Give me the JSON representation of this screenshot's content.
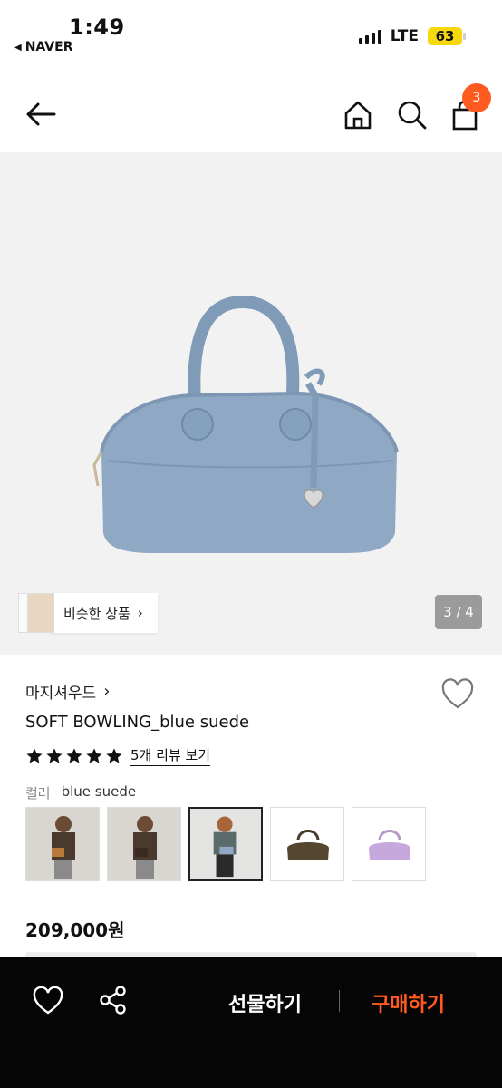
{
  "status_bar": {
    "time": "1:49",
    "back_app": "NAVER",
    "network": "LTE",
    "battery": "63"
  },
  "header": {
    "cart_count": "3",
    "icons": [
      "back-arrow-icon",
      "home-icon",
      "search-icon",
      "shopping-bag-icon"
    ]
  },
  "gallery": {
    "similar_label": "비슷한 상품",
    "counter": "3 / 4",
    "current_index": 3,
    "total": 4
  },
  "product": {
    "brand": "마지셔우드",
    "name": "SOFT BOWLING_blue suede",
    "rating_stars": 5,
    "review_link": "5개 리뷰 보기",
    "color_label": "컬러",
    "color_value": "blue suede",
    "price": "209,000원"
  },
  "colors": {
    "accent": "#ff5a1f",
    "bag_blue": "#8fa9c4",
    "bottom_bar": "#050505"
  },
  "bottom_bar": {
    "gift_label": "선물하기",
    "buy_label": "구매하기"
  }
}
